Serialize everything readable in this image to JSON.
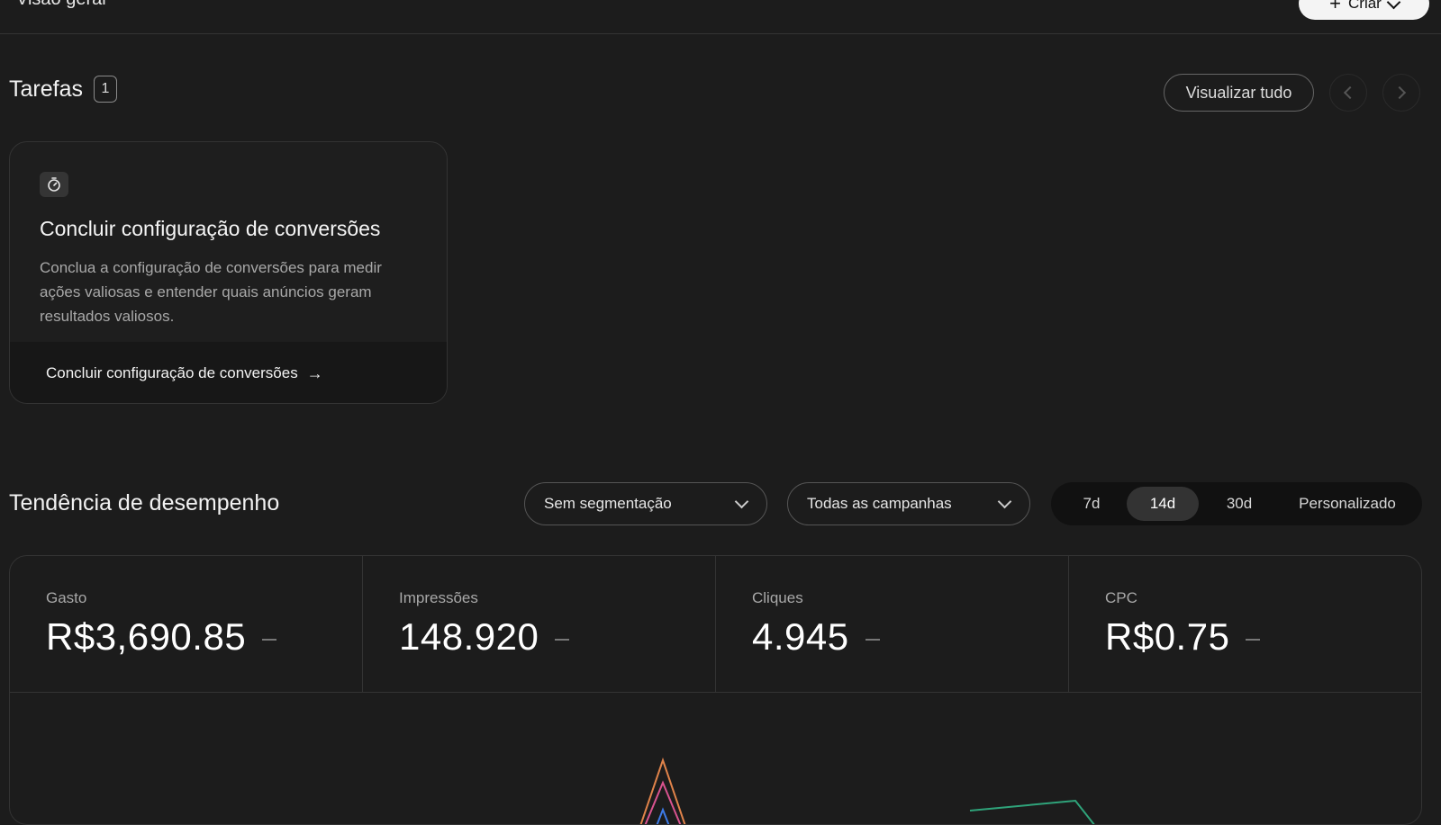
{
  "header": {
    "title": "Visão geral",
    "create_label": "Criar"
  },
  "tasks": {
    "title": "Tarefas",
    "count": "1",
    "view_all": "Visualizar tudo",
    "card": {
      "icon": "stopwatch-icon",
      "title": "Concluir configuração de conversões",
      "description": "Conclua a configuração de conversões para medir ações valiosas e entender quais anúncios geram resultados valiosos.",
      "action": "Concluir configuração de conversões"
    }
  },
  "performance": {
    "title": "Tendência de desempenho",
    "segment_value": "Sem segmentação",
    "campaign_value": "Todas as campanhas",
    "ranges": [
      "7d",
      "14d",
      "30d",
      "Personalizado"
    ],
    "active_range": "14d",
    "metrics": [
      {
        "label": "Gasto",
        "value": "R$3,690.85"
      },
      {
        "label": "Impressões",
        "value": "148.920"
      },
      {
        "label": "Cliques",
        "value": "4.945"
      },
      {
        "label": "CPC",
        "value": "R$0.75"
      }
    ]
  },
  "colors": {
    "background": "#1c1c1c",
    "line_orange": "#e0834a",
    "line_pink": "#d9538f",
    "line_blue": "#3d7be8",
    "line_green": "#2fa37a"
  }
}
